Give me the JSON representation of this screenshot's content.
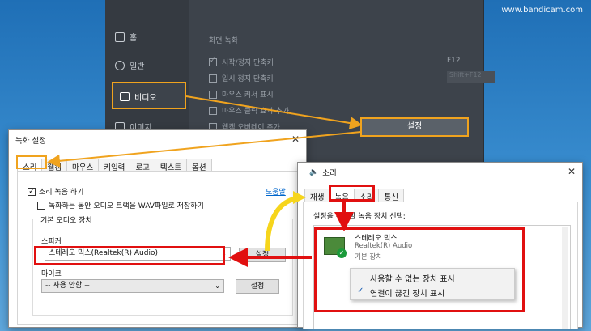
{
  "watermark": "www.bandicam.com",
  "bandicam": {
    "sidebar": [
      {
        "label": "홈",
        "icon": "home-icon"
      },
      {
        "label": "일반",
        "icon": "gear-icon"
      },
      {
        "label": "비디오",
        "icon": "video-icon"
      },
      {
        "label": "이미지",
        "icon": "image-icon"
      }
    ],
    "section_title": "화면 녹화",
    "options": [
      {
        "label": "시작/정지 단축키",
        "checked": true
      },
      {
        "label": "일시 정지 단축키",
        "checked": false
      },
      {
        "label": "마우스 커서 표시",
        "checked": false
      },
      {
        "label": "마우스 클릭 효과 추가",
        "checked": false
      },
      {
        "label": "웹캠 오버레이 추가",
        "checked": false
      }
    ],
    "hotkey": "F12",
    "hotkey2": "Shift+F12",
    "settings_button": "설정"
  },
  "record_dialog": {
    "title": "녹화 설정",
    "tabs": [
      "소리",
      "웹캠",
      "마우스",
      "키입력",
      "로고",
      "텍스트",
      "옵션"
    ],
    "record_sound": "소리 녹음 하기",
    "help_link": "도움말",
    "wav_option": "녹화하는 동안 오디오 트랙을 WAV파일로 저장하기",
    "group_title": "기본 오디오 장치",
    "speaker_label": "스피커",
    "speaker_value": "스테레오 믹스(Realtek(R) Audio)",
    "speaker_settings": "설정",
    "mic_label": "마이크",
    "mic_value": "-- 사용 안함 --",
    "mic_settings": "설정"
  },
  "sound_dialog": {
    "title": "소리",
    "tabs": [
      "재생",
      "녹음",
      "소리",
      "통신"
    ],
    "instruction": "설정을 수정할 녹음 장치 선택:",
    "device_name": "스테레오 믹스",
    "device_driver": "Realtek(R) Audio",
    "device_status": "기본 장치",
    "menu": [
      {
        "label": "사용할 수 없는 장치 표시",
        "checked": false
      },
      {
        "label": "연결이 끊긴 장치 표시",
        "checked": true
      }
    ]
  }
}
